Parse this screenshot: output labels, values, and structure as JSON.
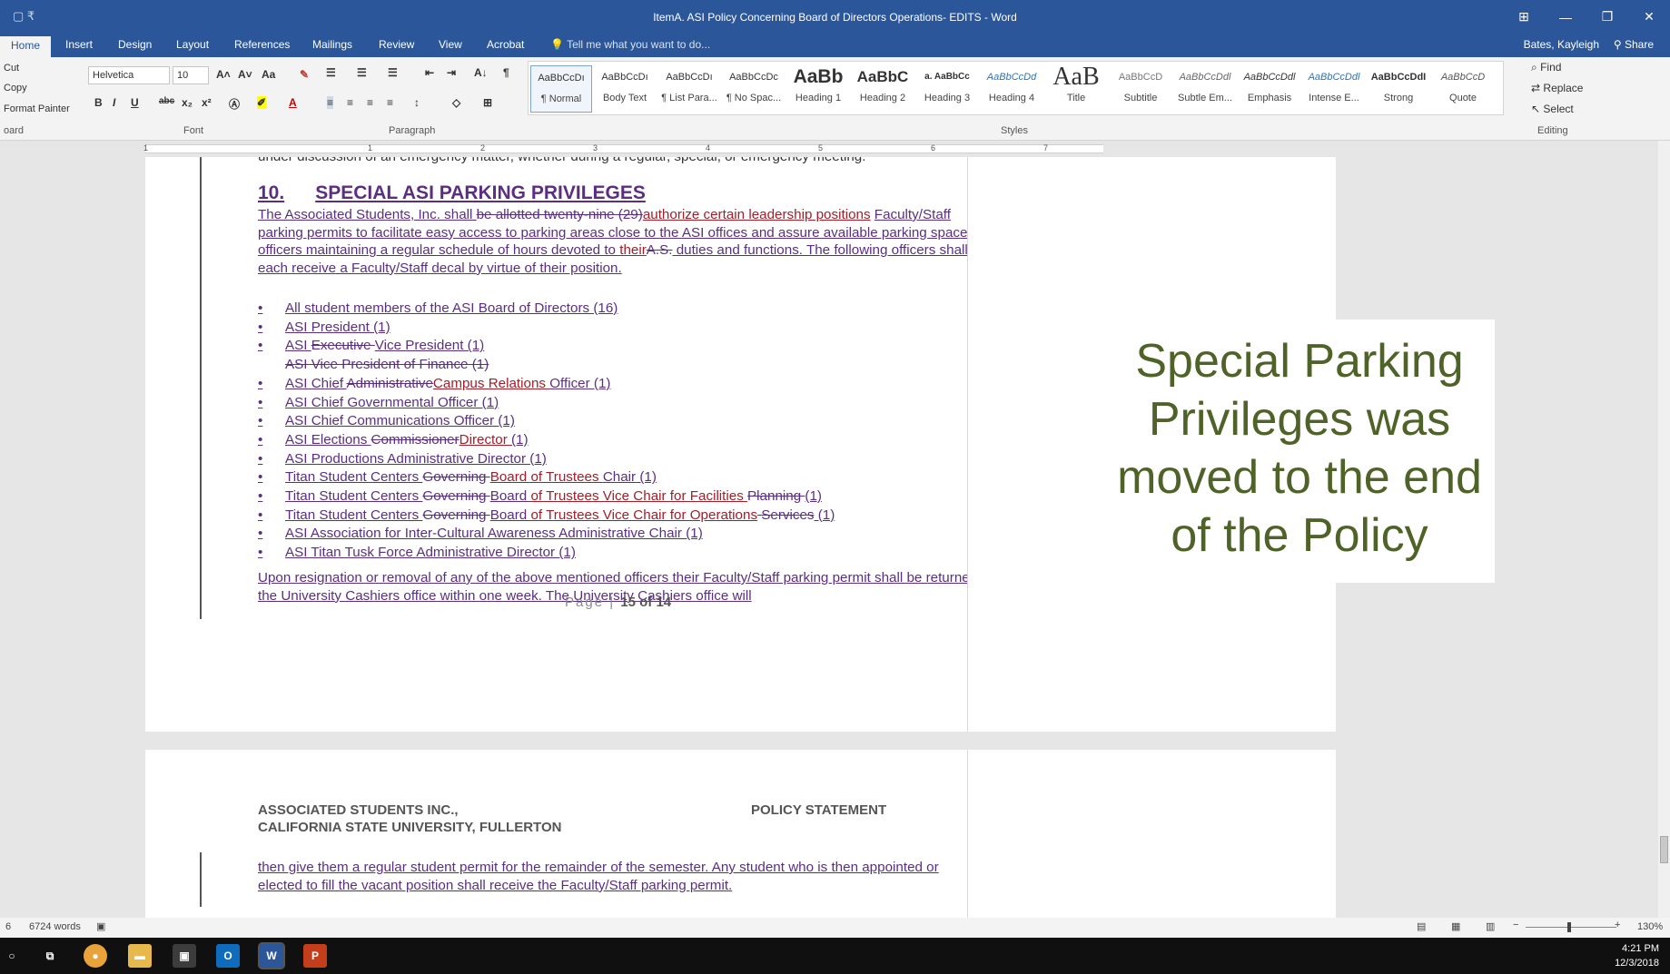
{
  "window": {
    "qat_label": "▢ ₹",
    "title": "ItemA. ASI Policy Concerning Board of Directors Operations- EDITS - Word",
    "controls": [
      "⊞",
      "—",
      "❐",
      "✕"
    ]
  },
  "tabs": {
    "items": [
      "Home",
      "Insert",
      "Design",
      "Layout",
      "References",
      "Mailings",
      "Review",
      "View",
      "Acrobat"
    ],
    "tell_me": "Tell me what you want to do...",
    "user": "Bates, Kayleigh",
    "share": "Share"
  },
  "ribbon": {
    "clipboard": {
      "cut": "Cut",
      "copy": "Copy",
      "format_painter": "Format Painter",
      "label": "oard"
    },
    "font": {
      "name": "Helvetica",
      "size": "10",
      "label": "Font",
      "bold": "B",
      "italic": "I",
      "underline": "U",
      "strike": "abc",
      "sub": "x₂",
      "sup": "x²",
      "grow": "A˄",
      "shrink": "A˅",
      "case": "Aa"
    },
    "paragraph": {
      "label": "Paragraph",
      "sort": "A↓",
      "pilcrow": "¶"
    },
    "styles": {
      "label": "Styles",
      "items": [
        {
          "preview": "AaBbCcDı",
          "name": "¶ Normal"
        },
        {
          "preview": "AaBbCcDı",
          "name": "Body Text"
        },
        {
          "preview": "AaBbCcDı",
          "name": "¶ List Para..."
        },
        {
          "preview": "AaBbCcDc",
          "name": "¶ No Spac..."
        },
        {
          "preview": "AaBb",
          "name": "Heading 1"
        },
        {
          "preview": "AaBbC",
          "name": "Heading 2"
        },
        {
          "preview": "a. AaBbCc",
          "name": "Heading 3"
        },
        {
          "preview": "AaBbCcDd",
          "name": "Heading 4"
        },
        {
          "preview": "AaB",
          "name": "Title"
        },
        {
          "preview": "AaBbCcD",
          "name": "Subtitle"
        },
        {
          "preview": "AaBbCcDdl",
          "name": "Subtle Em..."
        },
        {
          "preview": "AaBbCcDdl",
          "name": "Emphasis"
        },
        {
          "preview": "AaBbCcDdl",
          "name": "Intense E..."
        },
        {
          "preview": "AaBbCcDdI",
          "name": "Strong"
        },
        {
          "preview": "AaBbCcD",
          "name": "Quote"
        }
      ]
    },
    "editing": {
      "find": "Find",
      "replace": "Replace",
      "select": "Select",
      "label": "Editing"
    }
  },
  "ruler": {
    "numbers": [
      "1",
      "1",
      "2",
      "3",
      "4",
      "5",
      "6",
      "7"
    ]
  },
  "document": {
    "prev_line": "under discussion of an emergency matter, whether during a regular, special, or emergency meeting.",
    "heading_number": "10.",
    "heading_text": "SPECIAL ASI PARKING PRIVILEGES",
    "para1": {
      "a": "The Associated Students, Inc. shall ",
      "del1": "be allotted twenty-nine (29)",
      "ins1": "authorize certain leadership positions",
      "b": "Faculty/Staff parking permits to facilitate easy access to parking areas close to the ASI offices and assure available parking space for officers maintaining a regular schedule of hours devoted to ",
      "ins2": "their",
      "del2": "A.S.",
      "c": " duties and functions. The following officers shall each receive a Faculty/Staff decal by virtue of their position."
    },
    "bullets": [
      {
        "bullet": "•",
        "parts": [
          {
            "t": "All student members of the ASI Board of Directors (16)",
            "s": "ins"
          }
        ]
      },
      {
        "bullet": "•",
        "parts": [
          {
            "t": "ASI President (1)",
            "s": "ins"
          }
        ]
      },
      {
        "bullet": "•",
        "parts": [
          {
            "t": "ASI ",
            "s": "ins"
          },
          {
            "t": "Executive ",
            "s": "del"
          },
          {
            "t": "Vice President (1)",
            "s": "ins"
          }
        ]
      },
      {
        "bullet": "",
        "parts": [
          {
            "t": "ASI Vice President of Finance (1)",
            "s": "del"
          }
        ]
      },
      {
        "bullet": "•",
        "parts": [
          {
            "t": "ASI Chief ",
            "s": "ins"
          },
          {
            "t": "Administrative",
            "s": "del"
          },
          {
            "t": "Campus Relations ",
            "s": "insr"
          },
          {
            "t": "Officer (1)",
            "s": "ins"
          }
        ]
      },
      {
        "bullet": "•",
        "parts": [
          {
            "t": "ASI Chief Governmental Officer (1)",
            "s": "ins"
          }
        ]
      },
      {
        "bullet": "•",
        "parts": [
          {
            "t": "ASI Chief Communications Officer (1)",
            "s": "ins"
          }
        ]
      },
      {
        "bullet": "•",
        "parts": [
          {
            "t": "ASI Elections ",
            "s": "ins"
          },
          {
            "t": "Commissioner",
            "s": "del"
          },
          {
            "t": "Director ",
            "s": "insr"
          },
          {
            "t": "(1)",
            "s": "ins"
          }
        ]
      },
      {
        "bullet": "•",
        "parts": [
          {
            "t": "ASI Productions Administrative Director (1)",
            "s": "ins"
          }
        ]
      },
      {
        "bullet": "•",
        "parts": [
          {
            "t": "Titan Student Centers ",
            "s": "ins"
          },
          {
            "t": "Governing ",
            "s": "del"
          },
          {
            "t": "Board of Trustees ",
            "s": "insr"
          },
          {
            "t": "Chair (1)",
            "s": "ins"
          }
        ]
      },
      {
        "bullet": "•",
        "parts": [
          {
            "t": "Titan Student Centers ",
            "s": "ins"
          },
          {
            "t": "Governing ",
            "s": "del"
          },
          {
            "t": "Board ",
            "s": "ins"
          },
          {
            "t": "of Trustees Vice Chair for Facilities ",
            "s": "insr"
          },
          {
            "t": "Planning ",
            "s": "del"
          },
          {
            "t": "(1)",
            "s": "ins"
          }
        ]
      },
      {
        "bullet": "•",
        "parts": [
          {
            "t": "Titan Student Centers ",
            "s": "ins"
          },
          {
            "t": "Governing ",
            "s": "del"
          },
          {
            "t": "Board ",
            "s": "ins"
          },
          {
            "t": "of Trustees Vice Chair for Operations",
            "s": "insr"
          },
          {
            "t": " Services",
            "s": "del"
          },
          {
            "t": " (1)",
            "s": "ins"
          }
        ]
      },
      {
        "bullet": "•",
        "parts": [
          {
            "t": "ASI Association for Inter-Cultural Awareness Administrative Chair (1)",
            "s": "ins"
          }
        ]
      },
      {
        "bullet": "•",
        "parts": [
          {
            "t": "ASI Titan Tusk Force Administrative Director (1)",
            "s": "ins"
          }
        ]
      }
    ],
    "para2": "Upon resignation or removal of any of the above mentioned officers their Faculty/Staff parking permit shall be returned to the University Cashiers office within one week. The University Cashiers office will",
    "footer_prefix": "Page |",
    "footer_page": "15 of 14",
    "callout": "Special Parking Privileges was moved to the end of the Policy",
    "next_header_left1": "ASSOCIATED STUDENTS INC.,",
    "next_header_left2": "CALIFORNIA STATE UNIVERSITY, FULLERTON",
    "next_header_right": "POLICY STATEMENT",
    "next_para": "then give them a regular student permit for the remainder of the semester. Any student who is then appointed or elected to fill the vacant position shall receive the Faculty/Staff parking permit."
  },
  "status": {
    "page": "6",
    "words": "6724 words",
    "zoom": "130%"
  },
  "taskbar": {
    "time": "4:21 PM",
    "date": "12/3/2018"
  },
  "colors": {
    "title_blue": "#2b579a",
    "insert_purple": "#5b2e82",
    "insert_red": "#a31e28",
    "callout_green": "#4f6228"
  }
}
